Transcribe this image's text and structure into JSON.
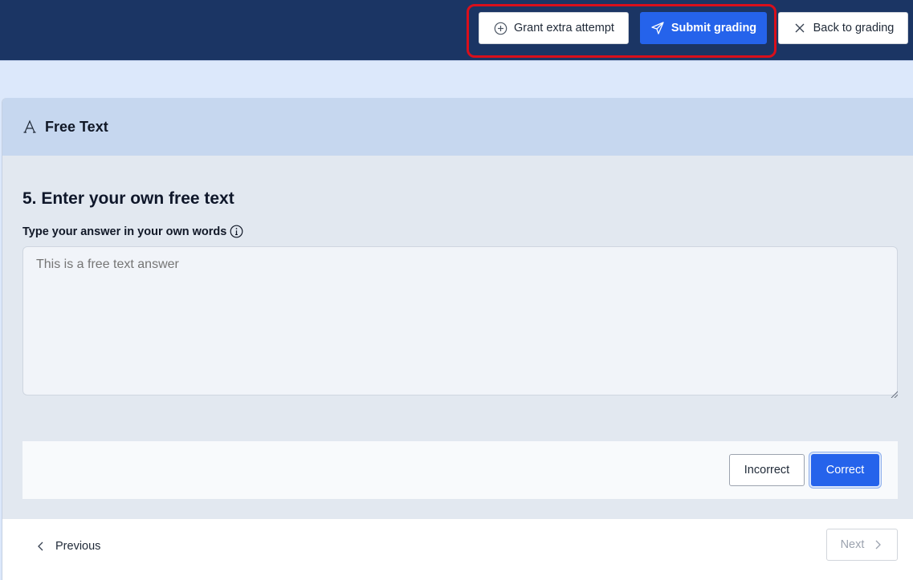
{
  "header": {
    "grant_label": "Grant extra attempt",
    "grant_icon": "plus-circle-icon",
    "submit_label": "Submit grading",
    "submit_icon": "send-icon",
    "back_label": "Back to grading",
    "back_icon": "close-icon",
    "highlight_color": "#d90f1b"
  },
  "question": {
    "type_label": "Free Text",
    "type_icon": "text-font-icon",
    "title": "5. Enter your own free text",
    "field_label": "Type your answer in your own words",
    "info_icon": "info-icon",
    "answer_placeholder": "This is a free text answer"
  },
  "grading": {
    "incorrect_label": "Incorrect",
    "correct_label": "Correct"
  },
  "footer": {
    "previous_label": "Previous",
    "next_label": "Next"
  },
  "colors": {
    "topbar": "#1b3564",
    "accent": "#2563eb",
    "card_header": "#c6d7ef"
  }
}
